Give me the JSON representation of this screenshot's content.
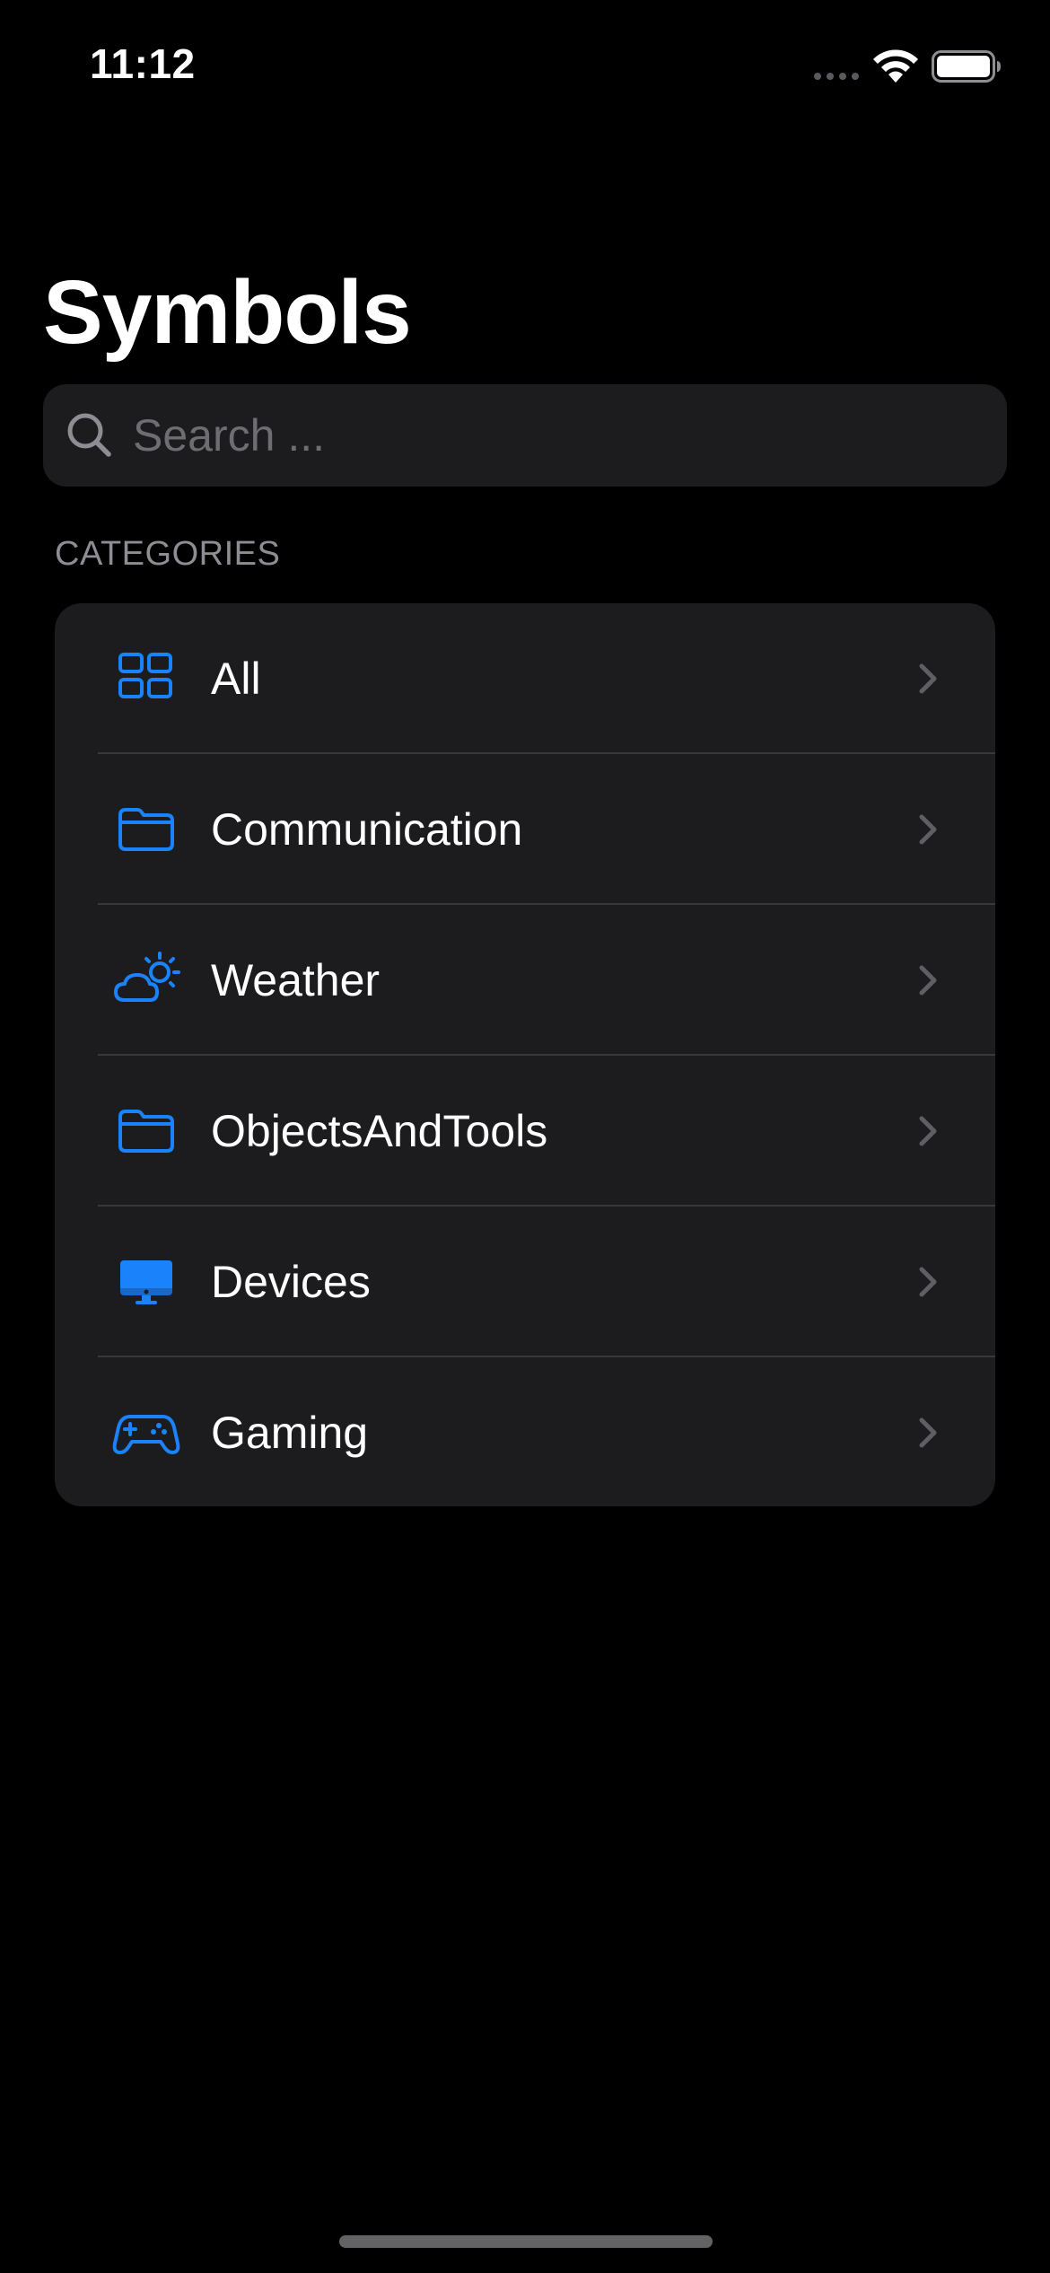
{
  "status_bar": {
    "time": "11:12"
  },
  "header": {
    "title": "Symbols"
  },
  "search": {
    "placeholder": "Search ...",
    "value": ""
  },
  "categories": {
    "header": "CATEGORIES",
    "items": [
      {
        "label": "All",
        "icon": "square-grid-icon"
      },
      {
        "label": "Communication",
        "icon": "folder-icon"
      },
      {
        "label": "Weather",
        "icon": "cloud-sun-icon"
      },
      {
        "label": "ObjectsAndTools",
        "icon": "folder-icon"
      },
      {
        "label": "Devices",
        "icon": "desktop-computer-icon"
      },
      {
        "label": "Gaming",
        "icon": "gamecontroller-icon"
      }
    ]
  },
  "colors": {
    "background": "#000000",
    "card": "#1c1c1e",
    "accent": "#1a82fb",
    "secondary_text": "#8d8d93",
    "separator": "#38383a"
  }
}
